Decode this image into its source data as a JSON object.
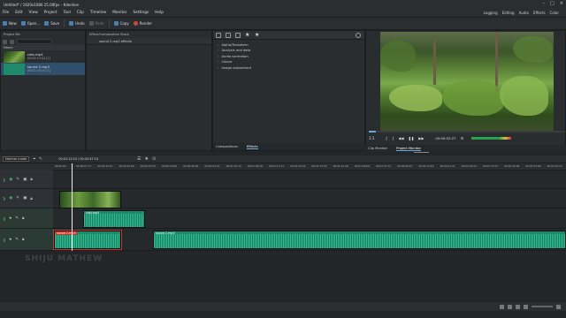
{
  "window": {
    "title": "Untitled* / 1920x1080 25.00fps – Kdenlive"
  },
  "menu": [
    "File",
    "Edit",
    "View",
    "Project",
    "Tool",
    "Clip",
    "Timeline",
    "Monitor",
    "Settings",
    "Help"
  ],
  "layouts": [
    "Logging",
    "Editing",
    "Audio",
    "Effects",
    "Color"
  ],
  "toolbar": {
    "new": "New",
    "open": "Open...",
    "save": "Save",
    "undo": "Undo",
    "redo": "Redo",
    "copy": "Copy",
    "render": "Render"
  },
  "project_bin": {
    "title": "Project Bin",
    "column_name": "Name",
    "clips": [
      {
        "name": "cats.mp4",
        "duration": "00:00:13:04 [1]",
        "kind": "video",
        "selected": false
      },
      {
        "name": "sound 2.mp3",
        "duration": "00:02:49:19 [2]",
        "kind": "audio",
        "selected": true
      }
    ]
  },
  "effect_stack": {
    "title": "Effect/Composition Stack",
    "target": "sound 2.mp3 effects"
  },
  "effects": {
    "categories": [
      "Alpha/Transform",
      "Analysis and data",
      "Audio correction",
      "Colour",
      "Image adjustment"
    ],
    "tabs": [
      "Compositions",
      "Effects"
    ]
  },
  "monitor": {
    "tabs": [
      "Clip Monitor",
      "Project Monitor"
    ],
    "zoom": "1:1",
    "timecode": "00:00:03:27",
    "tooltip": "Pause"
  },
  "timeline": {
    "edit_mode": "Normal mode",
    "position": "00:01:12:15 / 00:02:47:14",
    "ruler_ticks": [
      "00:00:00",
      "00:00:07:17",
      "00:00:15:21",
      "00:00:23:00",
      "00:00:31:03",
      "00:00:39:06",
      "00:00:46:09",
      "00:00:54:12",
      "00:01:02:10",
      "00:01:09:18",
      "00:01:17:21",
      "00:01:25:24",
      "00:01:33:03",
      "00:01:41:06",
      "00:01:49:09",
      "00:01:57:12",
      "00:02:05:15",
      "00:02:13:18",
      "00:02:21:21",
      "00:02:29:24",
      "00:02:37:03",
      "00:02:45:06",
      "00:02:53:09",
      "00:03:01:12"
    ],
    "clips": {
      "video_clip": "",
      "audio_a1": "cats.mp4",
      "audio_a2_first": "sound 2.mp3",
      "audio_a2_second": "sound 2.mp3"
    }
  },
  "watermark": "SHIJU MATHEW",
  "colors": {
    "accent": "#6aa6d8",
    "audio_clip": "#1f8a6b",
    "selected_label": "#c7362b",
    "eye": "#4ac06b"
  }
}
